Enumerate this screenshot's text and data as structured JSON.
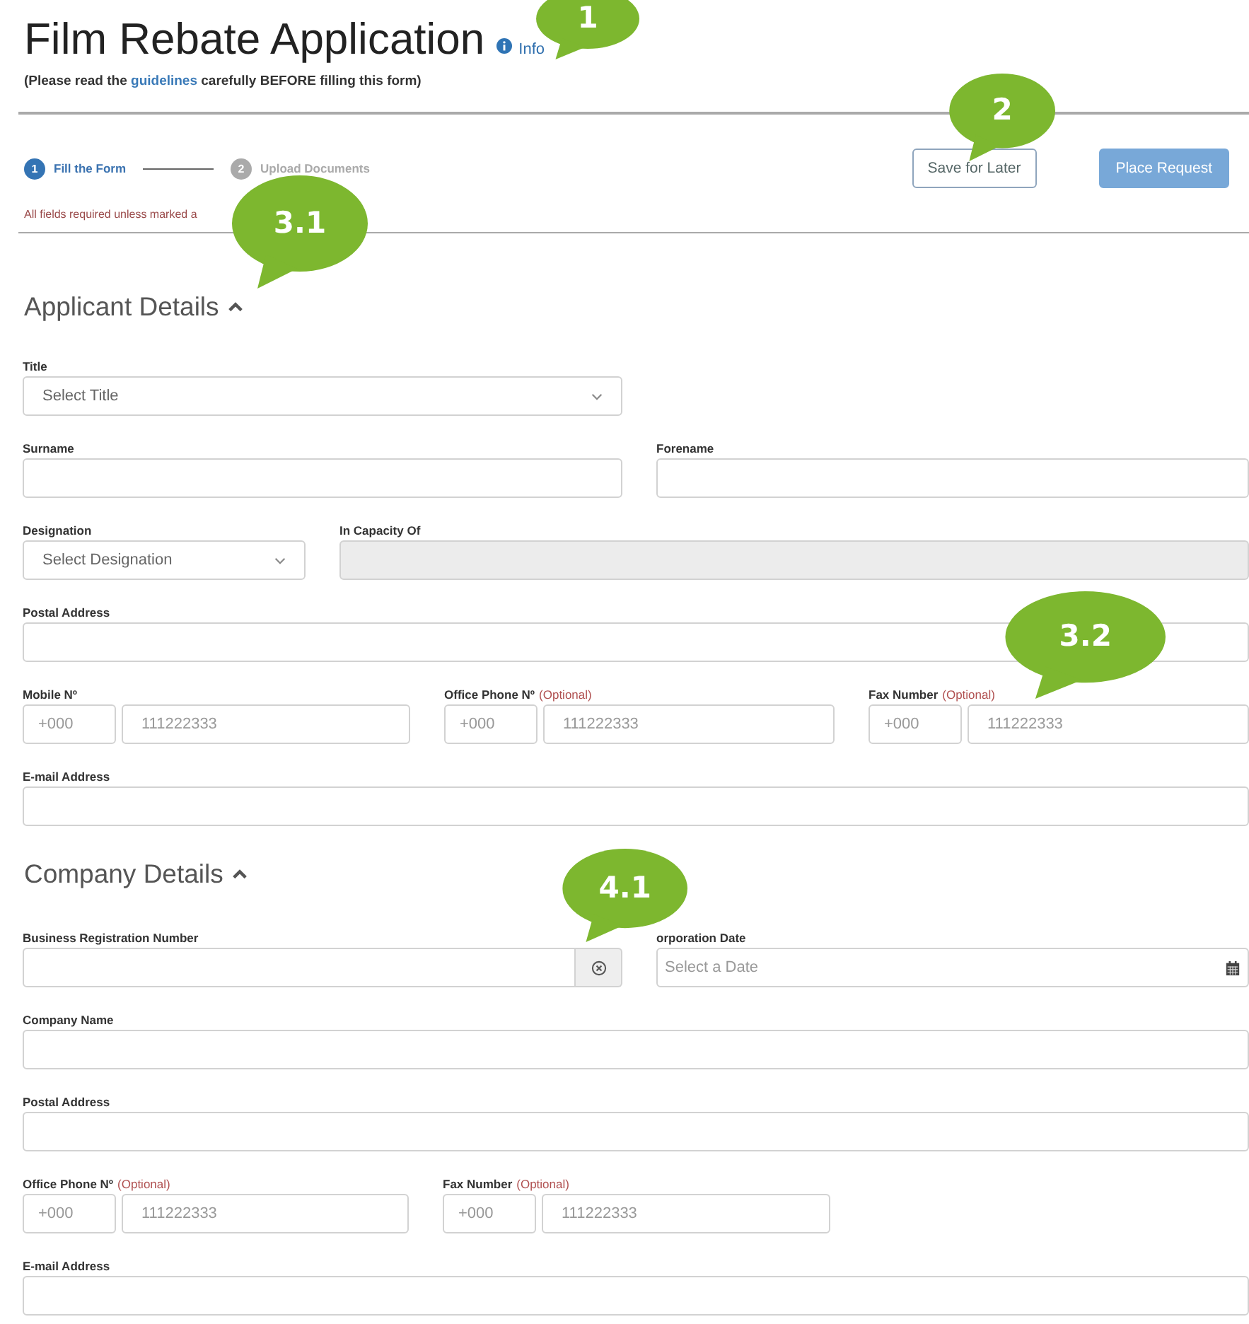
{
  "header": {
    "title": "Film Rebate Application",
    "info_link": "Info",
    "note_before": "(Please read the",
    "note_link": "guidelines",
    "note_after": "carefully BEFORE filling this form)"
  },
  "stepper": [
    {
      "number": "1",
      "label": "Fill the Form",
      "selected": true
    },
    {
      "number": "2",
      "label": "Upload Documents",
      "selected": false
    }
  ],
  "buttons": [
    {
      "label": "Save for Later",
      "kind": "outline"
    },
    {
      "label": "Place Request",
      "kind": "primary"
    }
  ],
  "required_note": "All fields required unless marked a",
  "sections": [
    {
      "title": "Applicant Details",
      "expanded": true,
      "rows": [
        {
          "kind": "half",
          "fields": [
            {
              "label": "Title",
              "kind": "select",
              "placeholder": "Select Title"
            }
          ]
        },
        {
          "kind": "half",
          "fields": [
            {
              "label": "Surname",
              "kind": "text"
            },
            {
              "label": "Forename",
              "kind": "text"
            }
          ]
        },
        {
          "kind": "narrow",
          "fields": [
            {
              "label": "Designation",
              "kind": "select",
              "placeholder": "Select Designation"
            },
            {
              "label": "In Capacity Of",
              "kind": "disabled"
            }
          ]
        },
        {
          "kind": "full",
          "fields": [
            {
              "label": "Postal Address",
              "kind": "text"
            }
          ]
        },
        {
          "kind": "thirds",
          "fields": [
            {
              "label": "Mobile Nº",
              "kind": "phone",
              "parts": [
                {
                  "placeholder": "+000"
                },
                {
                  "placeholder": "111222333"
                }
              ]
            },
            {
              "label": "Office Phone Nº",
              "optional": "(Optional)",
              "kind": "phone",
              "parts": [
                {
                  "placeholder": "+000"
                },
                {
                  "placeholder": "111222333"
                }
              ]
            },
            {
              "label": "Fax Number",
              "optional": "(Optional)",
              "kind": "phone",
              "parts": [
                {
                  "placeholder": "+000"
                },
                {
                  "placeholder": "111222333"
                }
              ]
            }
          ]
        },
        {
          "kind": "full",
          "fields": [
            {
              "label": "E-mail Address",
              "kind": "text"
            }
          ]
        }
      ]
    },
    {
      "title": "Company Details",
      "expanded": true,
      "rows": [
        {
          "kind": "half",
          "fields": [
            {
              "label": "Business Registration Number",
              "kind": "clearable"
            },
            {
              "label": "orporation Date",
              "kind": "date",
              "placeholder": "Select a Date"
            }
          ]
        },
        {
          "kind": "full",
          "fields": [
            {
              "label": "Company Name",
              "kind": "text"
            }
          ]
        },
        {
          "kind": "full",
          "fields": [
            {
              "label": "Postal Address",
              "kind": "text"
            }
          ]
        },
        {
          "kind": "thirds",
          "fields": [
            {
              "label": "Office Phone Nº",
              "optional": "(Optional)",
              "kind": "phone",
              "parts": [
                {
                  "placeholder": "+000"
                },
                {
                  "placeholder": "111222333"
                }
              ]
            },
            {
              "label": "Fax Number",
              "optional": "(Optional)",
              "kind": "phone",
              "parts": [
                {
                  "placeholder": "+000"
                },
                {
                  "placeholder": "111222333"
                }
              ]
            }
          ]
        },
        {
          "kind": "full",
          "fields": [
            {
              "label": "E-mail Address",
              "kind": "text"
            }
          ]
        }
      ]
    }
  ],
  "callouts": [
    "1",
    "2",
    "3.1",
    "3.2",
    "4.1"
  ]
}
